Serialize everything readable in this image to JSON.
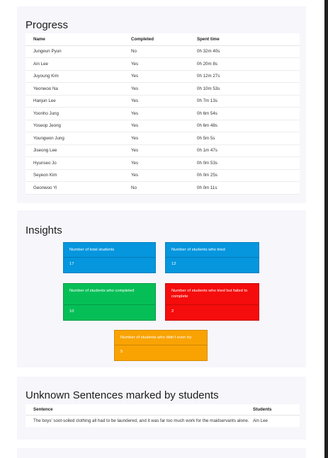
{
  "progress": {
    "title": "Progress",
    "columns": [
      "Name",
      "Completed",
      "Spent time"
    ],
    "rows": [
      [
        "Jungeun Pyun",
        "No",
        "0h 32m 40s"
      ],
      [
        "Ain Lee",
        "Yes",
        "0h 20m 8s"
      ],
      [
        "Juyoung Kim",
        "Yes",
        "0h 12m 27s"
      ],
      [
        "Yeonwoo Na",
        "Yes",
        "0h 10m 53s"
      ],
      [
        "Hanjun Lee",
        "Yes",
        "0h 7m 13s"
      ],
      [
        "Yoonho Jung",
        "Yes",
        "0h 6m 54s"
      ],
      [
        "Yoseop Jeong",
        "Yes",
        "0h 6m 48s"
      ],
      [
        "Youngwon Jung",
        "Yes",
        "0h 5m 5s"
      ],
      [
        "Jiseong Lee",
        "Yes",
        "0h 1m 47s"
      ],
      [
        "Hyunseo Jo",
        "Yes",
        "0h 0m 53s"
      ],
      [
        "Seyeon Kim",
        "Yes",
        "0h 0m 25s"
      ],
      [
        "Geonwoo Yi",
        "No",
        "0h 0m 11s"
      ]
    ]
  },
  "insights": {
    "title": "Insights",
    "tiles": [
      {
        "label": "Number of total students",
        "value": "17",
        "color": "#0596de"
      },
      {
        "label": "Number of students who tried",
        "value": "12",
        "color": "#0596de"
      },
      {
        "label": "Number of students who completed",
        "value": "10",
        "color": "#05bf56"
      },
      {
        "label": "Number of students who tried but failed to complete",
        "value": "2",
        "color": "#f50c0c"
      },
      {
        "label": "Number of students who didn't even try",
        "value": "5",
        "color": "#f9a303"
      }
    ]
  },
  "unknown": {
    "title": "Unknown Sentences marked by students",
    "columns": [
      "Sentence",
      "Students"
    ],
    "rows": [
      [
        "The boys' soot-soiled clothing all had to be laundered, and it was far too much work for the maidservants alone.",
        "Ain Lee"
      ]
    ]
  }
}
